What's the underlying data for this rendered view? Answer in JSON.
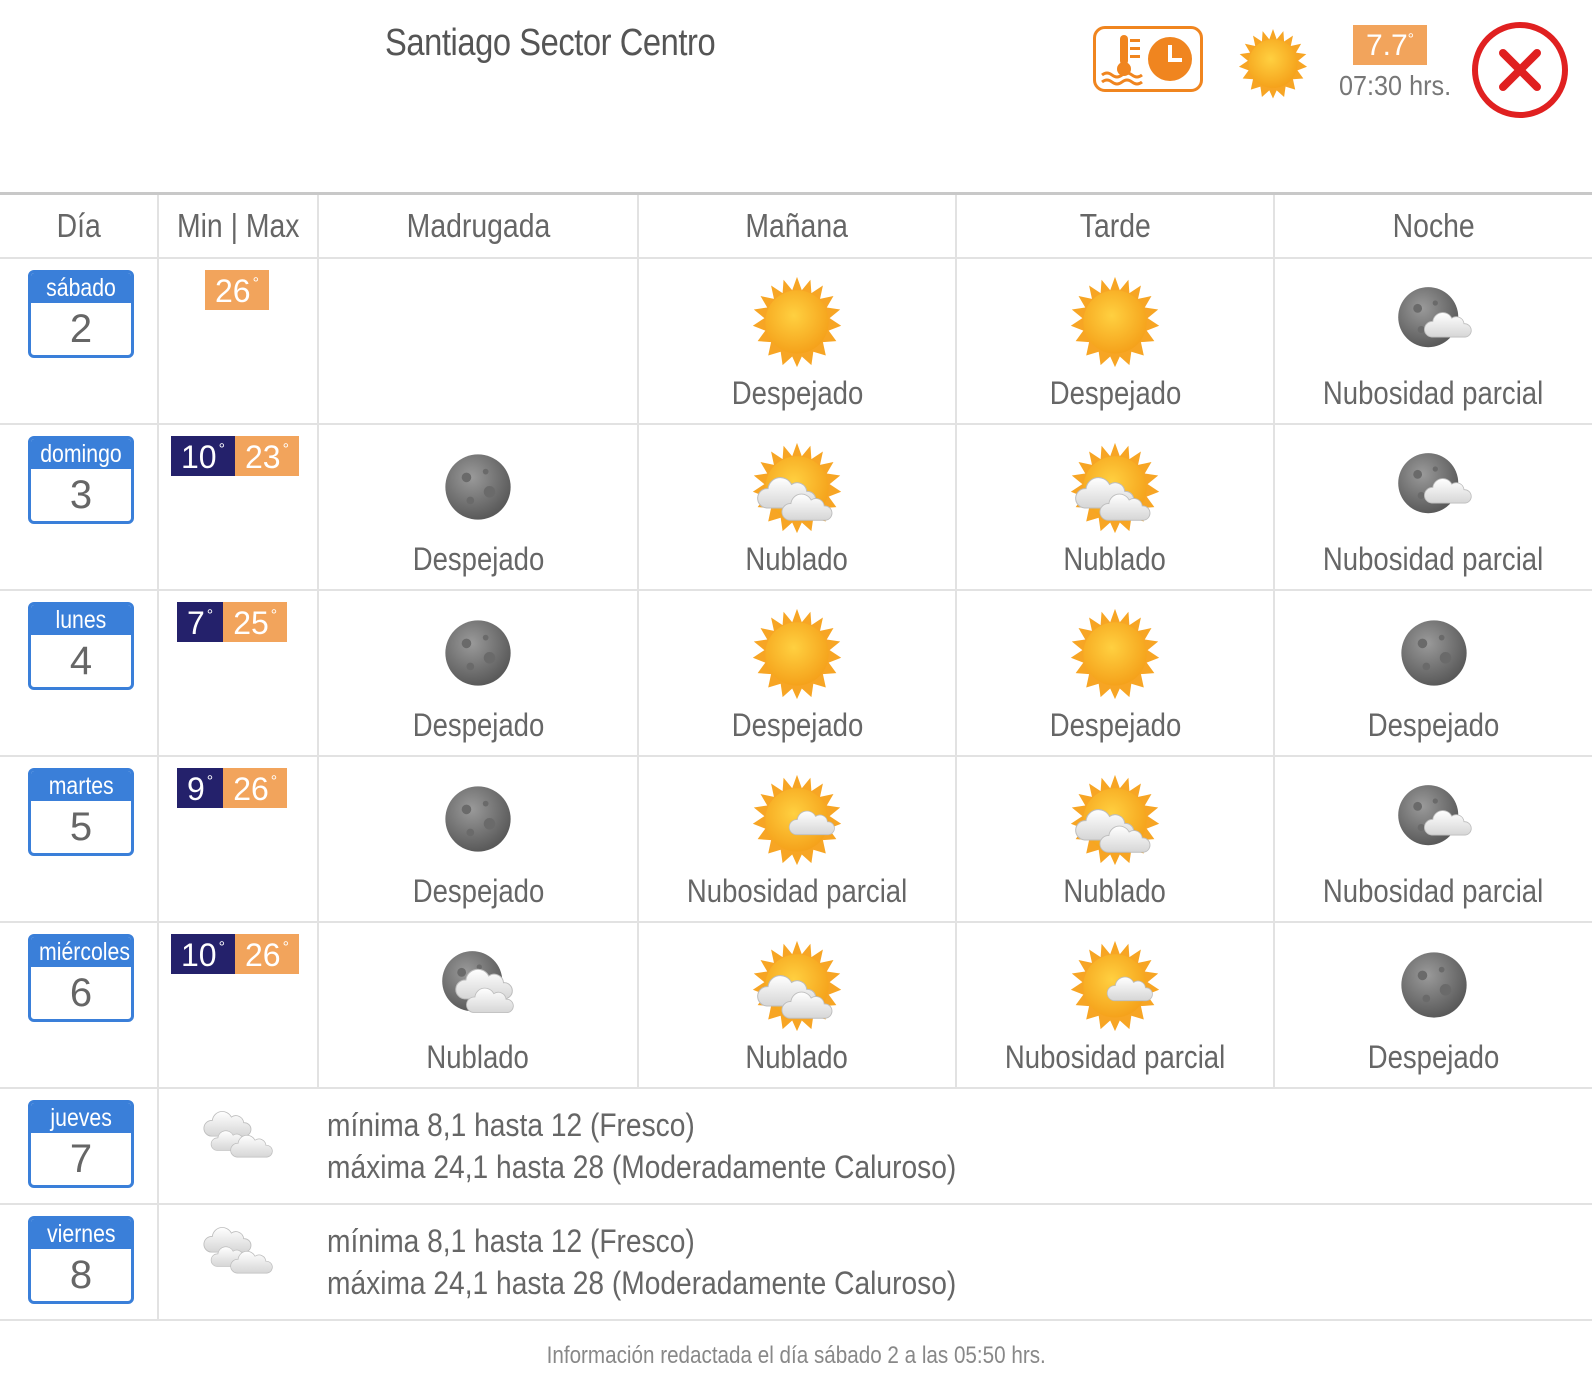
{
  "header": {
    "title": "Santiago Sector Centro",
    "current_temp": "7.7",
    "current_time": "07:30 hrs.",
    "temp_unit": "°"
  },
  "columns": [
    "Día",
    "Min | Max",
    "Madrugada",
    "Mañana",
    "Tarde",
    "Noche"
  ],
  "days": [
    {
      "name": "sábado",
      "num": "2",
      "min": "",
      "max": "26",
      "periods": [
        null,
        {
          "icon": "sun",
          "label": "Despejado"
        },
        {
          "icon": "sun",
          "label": "Despejado"
        },
        {
          "icon": "moon-partly",
          "label": "Nubosidad parcial"
        }
      ]
    },
    {
      "name": "domingo",
      "num": "3",
      "min": "10",
      "max": "23",
      "periods": [
        {
          "icon": "moon",
          "label": "Despejado"
        },
        {
          "icon": "sun-cloudy",
          "label": "Nublado"
        },
        {
          "icon": "sun-cloudy",
          "label": "Nublado"
        },
        {
          "icon": "moon-partly",
          "label": "Nubosidad parcial"
        }
      ]
    },
    {
      "name": "lunes",
      "num": "4",
      "min": "7",
      "max": "25",
      "periods": [
        {
          "icon": "moon",
          "label": "Despejado"
        },
        {
          "icon": "sun",
          "label": "Despejado"
        },
        {
          "icon": "sun",
          "label": "Despejado"
        },
        {
          "icon": "moon",
          "label": "Despejado"
        }
      ]
    },
    {
      "name": "martes",
      "num": "5",
      "min": "9",
      "max": "26",
      "periods": [
        {
          "icon": "moon",
          "label": "Despejado"
        },
        {
          "icon": "sun-partly",
          "label": "Nubosidad parcial"
        },
        {
          "icon": "sun-cloudy",
          "label": "Nublado"
        },
        {
          "icon": "moon-partly",
          "label": "Nubosidad parcial"
        }
      ]
    },
    {
      "name": "miércoles",
      "num": "6",
      "min": "10",
      "max": "26",
      "periods": [
        {
          "icon": "moon-cloudy",
          "label": "Nublado"
        },
        {
          "icon": "sun-cloudy",
          "label": "Nublado"
        },
        {
          "icon": "sun-partly",
          "label": "Nubosidad parcial"
        },
        {
          "icon": "moon",
          "label": "Despejado"
        }
      ]
    }
  ],
  "extended": [
    {
      "name": "jueves",
      "num": "7",
      "icon": "clouds",
      "line1": "mínima 8,1 hasta 12 (Fresco)",
      "line2": "máxima 24,1 hasta 28 (Moderadamente Caluroso)"
    },
    {
      "name": "viernes",
      "num": "8",
      "icon": "clouds",
      "line1": "mínima 8,1 hasta 12 (Fresco)",
      "line2": "máxima 24,1 hasta 28 (Moderadamente Caluroso)"
    }
  ],
  "footer": "Información redactada el día sábado 2 a las 05:50 hrs.",
  "colors": {
    "accent": "#3a7fd9",
    "min": "#24216b",
    "max": "#f2a45c",
    "close": "#e02020",
    "orange": "#f0851f"
  }
}
